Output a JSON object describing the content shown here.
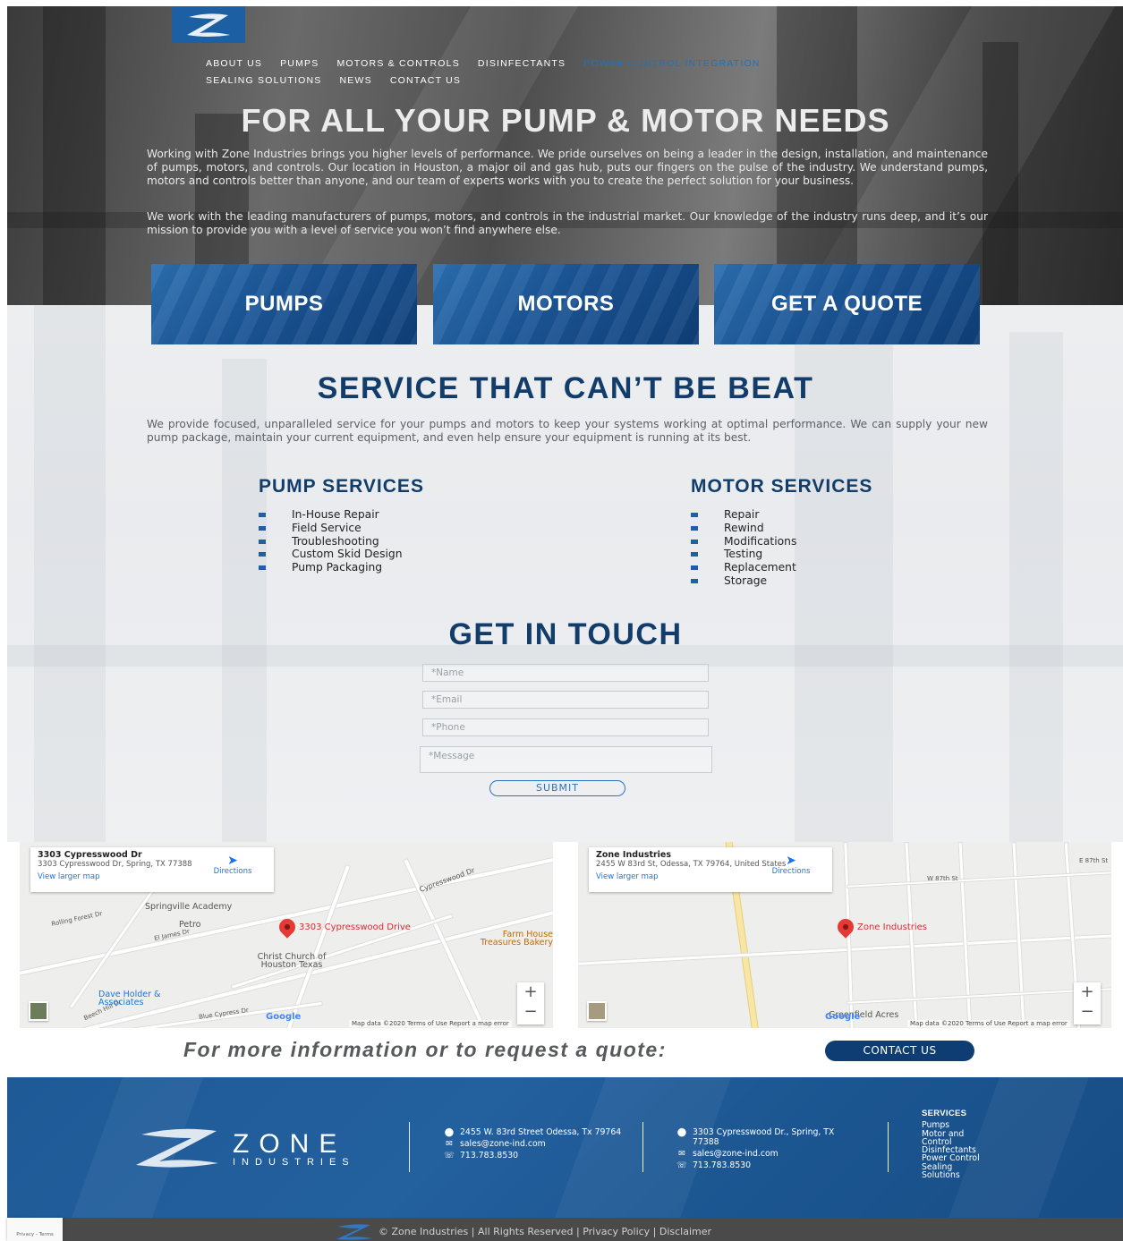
{
  "nav": {
    "items": [
      {
        "label": "ABOUT US"
      },
      {
        "label": "PUMPS"
      },
      {
        "label": "MOTORS & CONTROLS"
      },
      {
        "label": "DISINFECTANTS"
      },
      {
        "label": "POWER CONTROL INTEGRATION"
      },
      {
        "label": "SEALING SOLUTIONS"
      },
      {
        "label": "NEWS"
      },
      {
        "label": "CONTACT US"
      }
    ],
    "active_color": "#1e73be"
  },
  "hero": {
    "title": "FOR ALL YOUR PUMP & MOTOR NEEDS",
    "p1": "Working with Zone Industries brings you higher levels of performance. We pride ourselves on being a leader in the design, installation, and maintenance of pumps, motors, and controls. Our location in Houston, a major oil and gas hub, puts our fingers on the pulse of the industry. We understand pumps, motors and controls better than anyone, and our team of experts works with you to create the perfect solution for your business.",
    "p2": "We work with the leading manufacturers of pumps, motors, and controls in the industrial market. Our knowledge of the industry runs deep, and it’s our mission to provide you with a level of service you won’t find anywhere else."
  },
  "tiles": [
    {
      "label": "PUMPS"
    },
    {
      "label": "MOTORS"
    },
    {
      "label": "GET A QUOTE"
    }
  ],
  "service": {
    "title": "SERVICE THAT CAN’T BE BEAT",
    "text": "We provide focused, unparalleled service for your pumps and motors to keep your systems working at optimal performance. We can supply your new pump package, maintain your current equipment, and even help ensure your equipment is running at its best.",
    "pump": {
      "heading": "PUMP SERVICES",
      "items": [
        "In-House Repair",
        "Field Service",
        "Troubleshooting",
        "Custom Skid Design",
        "Pump Packaging"
      ]
    },
    "motor": {
      "heading": "MOTOR SERVICES",
      "items": [
        "Repair",
        "Rewind",
        "Modifications",
        "Testing",
        "Replacement",
        "Storage"
      ]
    }
  },
  "contact_form": {
    "title": "GET IN TOUCH",
    "name_placeholder": "*Name",
    "email_placeholder": "*Email",
    "phone_placeholder": "*Phone",
    "message_placeholder": "*Message",
    "submit": "SUBMIT"
  },
  "map_left": {
    "title": "3303 Cypresswood Dr",
    "address": "3303 Cypresswood Dr, Spring, TX 77388",
    "directions": "Directions",
    "larger": "View larger map",
    "pin_label": "3303 Cypresswood Drive",
    "pois": [
      "Springville Academy",
      "Petro",
      "Christ Church of Houston Texas",
      "Dave Holder & Associates",
      "Farm House Treasures Bakery",
      "Cypresswood Dr",
      "El James Dr",
      "Rolling Forest Dr",
      "Blue Cypress Dr",
      "Beech Hill Dr"
    ],
    "google": "Google",
    "attribution": "Map data ©2020   Terms of Use   Report a map error"
  },
  "map_right": {
    "title": "Zone Industries",
    "address": "2455 W 83rd St, Odessa, TX 79764, United States",
    "directions": "Directions",
    "larger": "View larger map",
    "pin_label": "Zone Industries",
    "pois": [
      "Greenfield Acres",
      "W 87th St",
      "E 87th St"
    ],
    "google": "Google",
    "attribution": "Map data ©2020   Terms of Use   Report a map error"
  },
  "cta": {
    "text": "For more information or to request a quote:",
    "button": "CONTACT US"
  },
  "footer": {
    "brand": "ZONE",
    "brand_sub": "INDUSTRIES",
    "loc1": {
      "address": "2455 W. 83rd Street Odessa, Tx 79764",
      "email": "sales@zone-ind.com",
      "phone": "713.783.8530"
    },
    "loc2": {
      "address": "3303 Cypresswood Dr., Spring, TX 77388",
      "email": "sales@zone-ind.com",
      "phone": "713.783.8530"
    },
    "services_heading": "SERVICES",
    "services": [
      "Pumps",
      "Motor and Control",
      "Disinfectants",
      "Power Control",
      "Sealing Solutions"
    ],
    "copyright": "© Zone Industries | All Rights Reserved | Privacy Policy | Disclaimer",
    "recaptcha": "Privacy - Terms"
  },
  "colors": {
    "brand_blue": "#1d5fa3",
    "heading_navy": "#123d6b",
    "cta_navy": "#0d3d73"
  }
}
